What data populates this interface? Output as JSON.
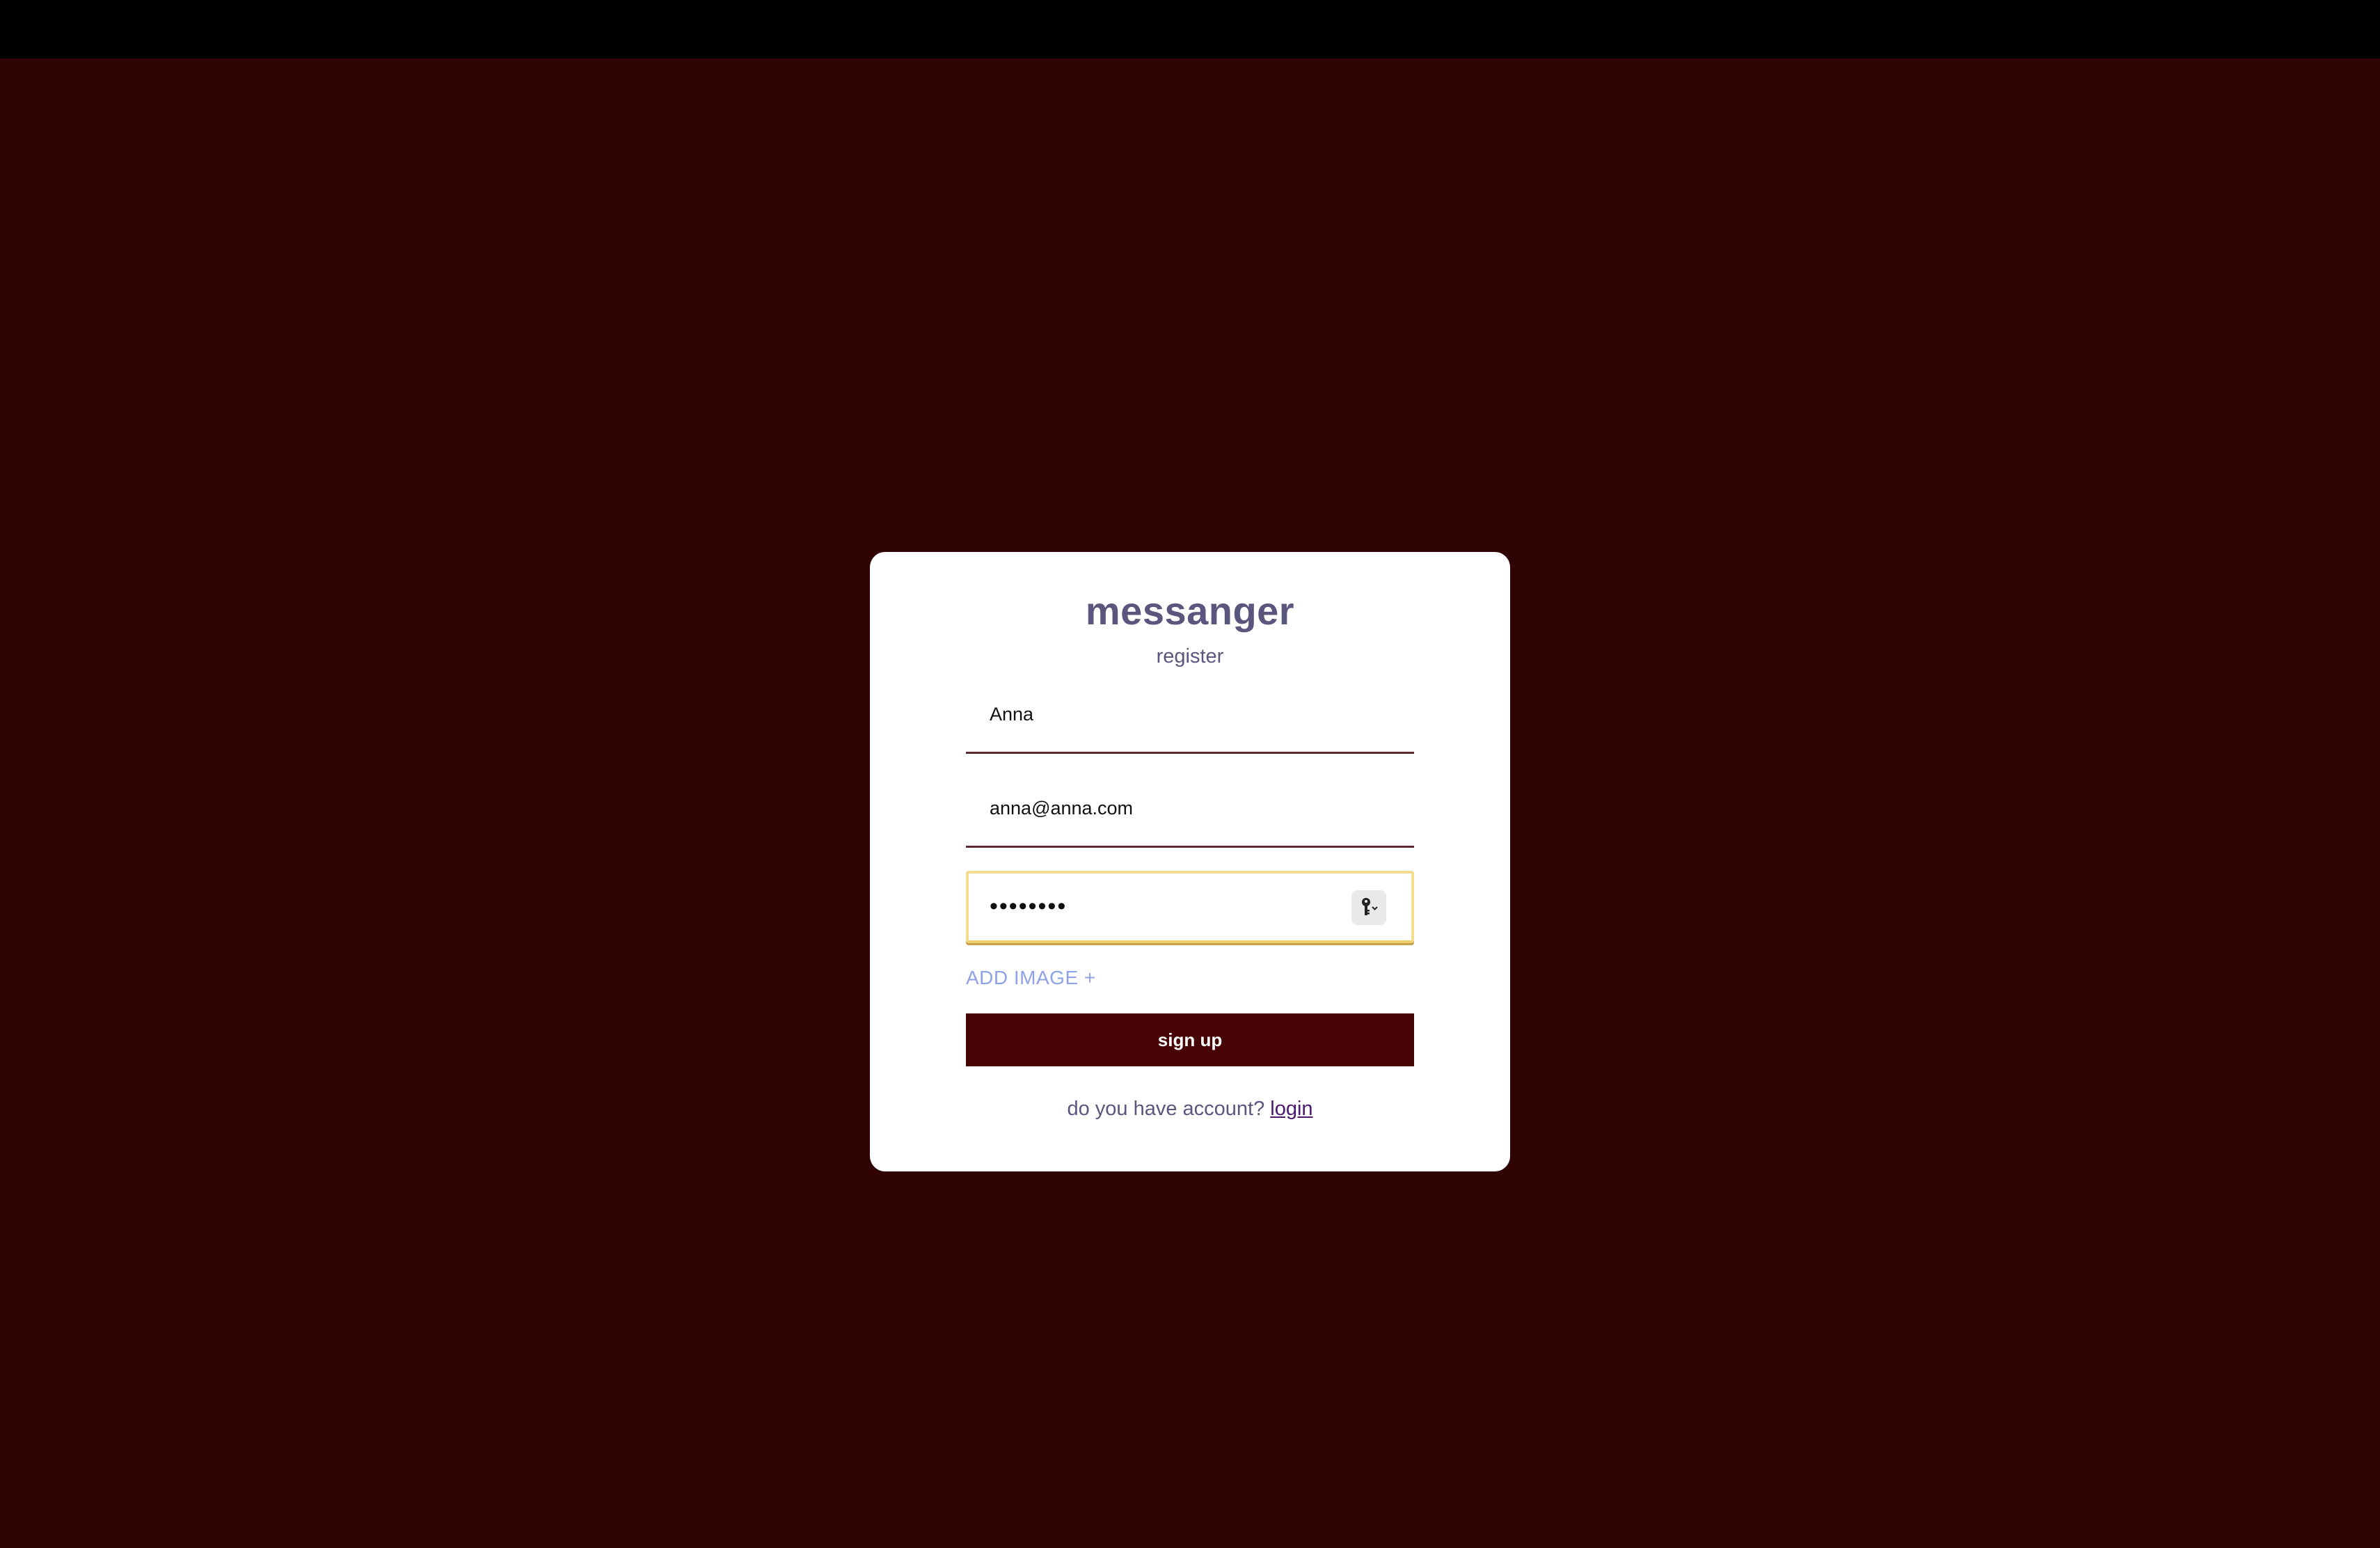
{
  "app": {
    "title": "messanger",
    "subtitle": "register"
  },
  "form": {
    "name_value": "Anna",
    "email_value": "anna@anna.com",
    "password_value": "••••••••",
    "add_image_label": "ADD IMAGE +",
    "submit_label": "sign up"
  },
  "footer": {
    "prompt": "do you have account?",
    "login_label": "login"
  },
  "colors": {
    "background": "#300304",
    "card": "#ffffff",
    "accent_button": "#460406",
    "title": "#5a567e",
    "link_add_image": "#8fa2e6",
    "focus_outline": "#f3dc8e"
  },
  "icons": {
    "password_manager": "key-icon"
  }
}
